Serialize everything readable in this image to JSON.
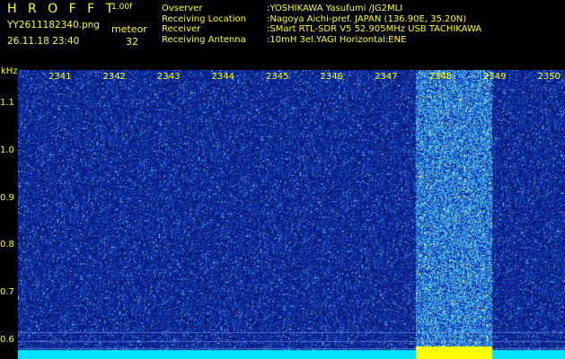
{
  "app": {
    "name": "H R O F F T",
    "version": "1.00f"
  },
  "file": {
    "name": "YY2611182340.png",
    "datetime": "26.11.18 23:40"
  },
  "counter": {
    "label": "meteor",
    "value": "32"
  },
  "station": {
    "overseer_label": "Ovserver",
    "overseer_value": ":YOSHIKAWA Yasufumi /JG2MLI",
    "location_label": "Receiving Location",
    "location_value": ":Nagoya Aichi-pref. JAPAN (136.90E, 35.20N)",
    "receiver_label": "Receiver",
    "receiver_value": ":SMart RTL-SDR V5 52.905MHz USB TACHIKAWA",
    "antenna_label": "Receiving Antenna",
    "antenna_value": ":10mH 3el.YAGI Horizontal:ENE"
  },
  "chart_data": {
    "type": "heatmap",
    "ylabel": "kHz",
    "yticks": [
      "1.1",
      "1.0",
      "0.9",
      "0.8",
      "0.7",
      "0.6"
    ],
    "ylim": [
      0.56,
      1.17
    ],
    "x_time_labels": [
      "2341",
      "2342",
      "2343",
      "2344",
      "2345",
      "2346",
      "2347",
      "2348",
      "2349",
      "2350"
    ],
    "event_band_label": "2348",
    "colors": {
      "bg_noise": "#0a1f8f",
      "event": "#30b0e8",
      "floor": "#00e0ff",
      "floor_event": "#ffff00",
      "text": "#ffff00"
    }
  }
}
